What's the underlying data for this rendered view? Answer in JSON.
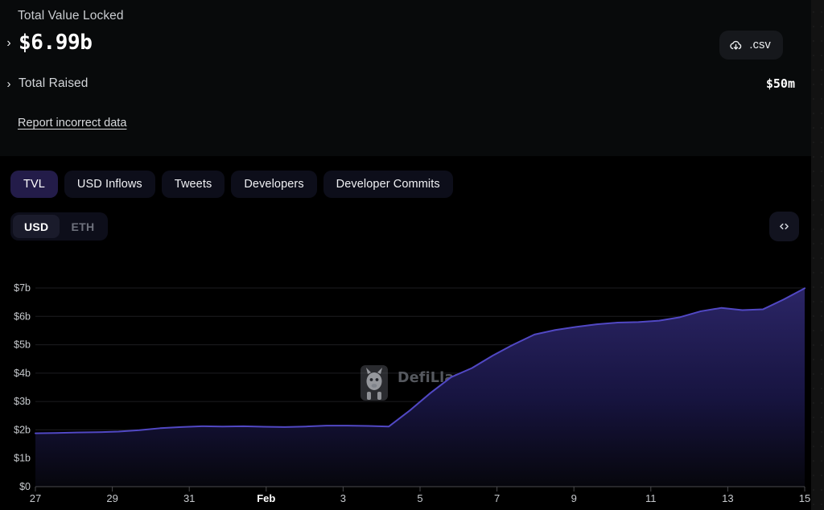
{
  "summary": {
    "tvl_label": "Total Value Locked",
    "tvl_value": "$6.99b",
    "tvl_chevron": "›",
    "raised_label": "Total Raised",
    "raised_value": "$50m",
    "raised_chevron": "›",
    "report_link": "Report incorrect data",
    "csv_label": ".csv",
    "csv_icon": "cloud-download-icon"
  },
  "tabs": [
    {
      "label": "TVL",
      "active": true
    },
    {
      "label": "USD Inflows",
      "active": false
    },
    {
      "label": "Tweets",
      "active": false
    },
    {
      "label": "Developers",
      "active": false
    },
    {
      "label": "Developer Commits",
      "active": false
    }
  ],
  "denomination": {
    "options": [
      {
        "label": "USD",
        "selected": true
      },
      {
        "label": "ETH",
        "selected": false
      }
    ]
  },
  "embed": {
    "icon": "code-brackets-icon",
    "title": "Embed chart"
  },
  "watermark": {
    "text": "DefiLlama",
    "logo": "llama-logo-icon"
  },
  "colors": {
    "accent_line": "#5148c4",
    "accent_tab_active": "#231c49",
    "page_background": "#000000",
    "card_background": "#080a0b",
    "area_fill_top": "#2b2566",
    "area_fill_bottom": "#06060c",
    "grid_line": "#1d1d20",
    "text_primary": "#ffffff",
    "text_secondary": "#c7cace"
  },
  "chart_data": {
    "type": "area",
    "title": "Total Value Locked",
    "xlabel": "",
    "ylabel": "",
    "ylim": [
      0,
      7000000000
    ],
    "ytick_labels": [
      "$0",
      "$1b",
      "$2b",
      "$3b",
      "$4b",
      "$5b",
      "$6b",
      "$7b"
    ],
    "ytick_values": [
      0,
      1,
      2,
      3,
      4,
      5,
      6,
      7
    ],
    "xtick_labels": [
      "27",
      "29",
      "31",
      "Feb",
      "3",
      "5",
      "7",
      "9",
      "11",
      "13",
      "15"
    ],
    "xtick_bold": [
      "Feb"
    ],
    "grid": true,
    "legend": false,
    "unit": "billions USD",
    "series": [
      {
        "name": "TVL",
        "color": "#5148c4",
        "x": [
          "27",
          "27.5",
          "28",
          "28.5",
          "29",
          "29.5",
          "30",
          "30.5",
          "31",
          "Feb",
          "1.5",
          "2",
          "2.5",
          "3",
          "3.5",
          "4",
          "4.5",
          "5",
          "5.5",
          "6",
          "6.5",
          "7",
          "7.5",
          "8",
          "8.5",
          "9",
          "9.5",
          "10",
          "10.5",
          "11",
          "11.5",
          "12",
          "12.5",
          "13",
          "13.5",
          "14",
          "14.5",
          "15"
        ],
        "values": [
          1.88,
          1.89,
          1.91,
          1.92,
          1.94,
          1.99,
          2.06,
          2.1,
          2.13,
          2.12,
          2.13,
          2.11,
          2.1,
          2.12,
          2.15,
          2.15,
          2.14,
          2.12,
          2.68,
          3.3,
          3.86,
          4.18,
          4.62,
          5.01,
          5.36,
          5.52,
          5.63,
          5.72,
          5.78,
          5.8,
          5.85,
          5.97,
          6.18,
          6.3,
          6.22,
          6.25,
          6.6,
          6.99
        ]
      }
    ]
  }
}
